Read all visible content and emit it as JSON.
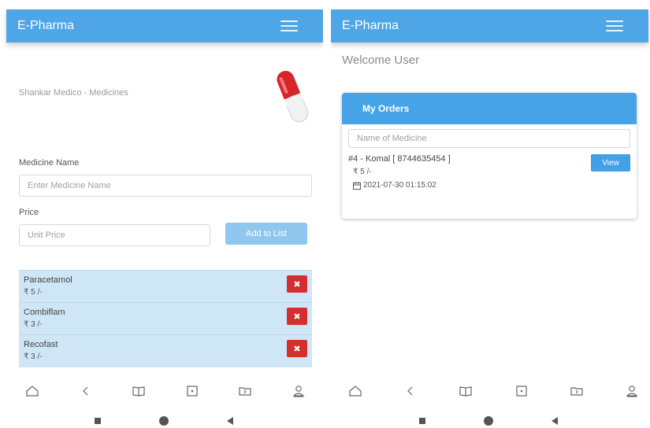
{
  "left": {
    "appbar": {
      "title": "E-Pharma"
    },
    "store_title": "Shankar Medico - Medicines",
    "form": {
      "medicine_label": "Medicine Name",
      "medicine_placeholder": "Enter Medicine Name",
      "price_label": "Price",
      "price_placeholder": "Unit Price",
      "add_button": "Add to List"
    },
    "medicines": [
      {
        "name": "Paracetamol",
        "price": "₹ 5 /-",
        "delete": "✖"
      },
      {
        "name": "Combiflam",
        "price": "₹ 3 /-",
        "delete": "✖"
      },
      {
        "name": "Recofast",
        "price": "₹ 3 /-",
        "delete": "✖"
      }
    ]
  },
  "right": {
    "appbar": {
      "title": "E-Pharma"
    },
    "welcome": "Welcome User",
    "orders": {
      "header": "My Orders",
      "search_placeholder": "Name of Medicine",
      "items": [
        {
          "title": "#4 - Komal [ 8744635454 ]",
          "price": "₹ 5 /-",
          "datetime": "2021-07-30 01:15:02",
          "view": "View"
        }
      ]
    }
  },
  "icons": {
    "menu": "hamburger-menu-icon",
    "nav": [
      "home-icon",
      "back-chevron-icon",
      "book-icon",
      "square-dot-icon",
      "folder-icon",
      "user-icon"
    ],
    "calendar": "calendar-icon"
  },
  "colors": {
    "appbar": "#4ea6e6",
    "card_header": "#45a3e6",
    "list_bg": "#cfe6f6",
    "delete": "#d32f2f",
    "add_button": "#8fc7ef",
    "view_button": "#42a0e6"
  }
}
